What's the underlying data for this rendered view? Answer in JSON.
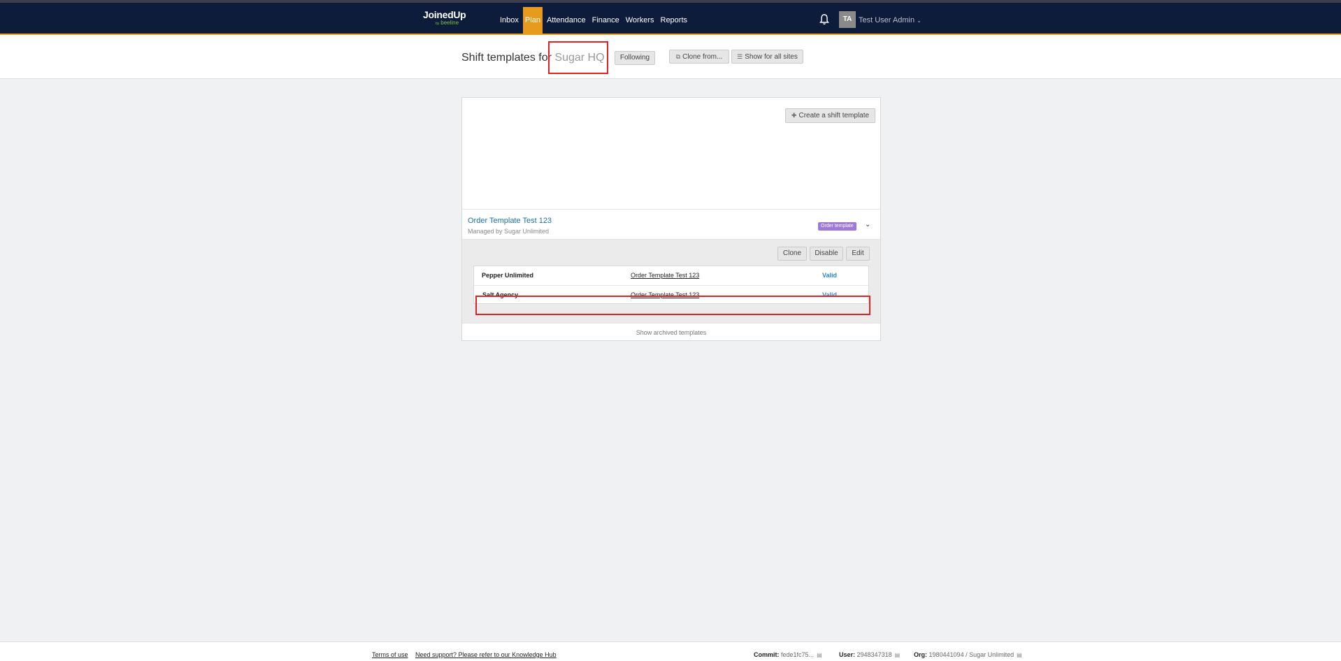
{
  "nav": {
    "logo_main": "JoinedUp",
    "logo_by": "by",
    "logo_sub": "beeline",
    "items": [
      {
        "label": "Inbox",
        "active": false
      },
      {
        "label": "Plan",
        "active": true
      },
      {
        "label": "Attendance",
        "active": false
      },
      {
        "label": "Finance",
        "active": false
      },
      {
        "label": "Workers",
        "active": false
      },
      {
        "label": "Reports",
        "active": false
      }
    ],
    "avatar_initials": "TA",
    "user_name": "Test User Admin",
    "accent": "#e69a1e",
    "bg": "#0e1c3b"
  },
  "header": {
    "title_prefix": "Shift templates for ",
    "site_name": "Sugar HQ",
    "following_label": "Following",
    "clone_label": "Clone from...",
    "show_all_label": "Show for all sites"
  },
  "card": {
    "create_label": "Create a shift template",
    "template": {
      "name": "Order Template Test 123",
      "managed_by": "Managed by Sugar Unlimited",
      "badge": "Order template",
      "badge_color": "#9e79d6"
    },
    "actions": {
      "clone": "Clone",
      "disable": "Disable",
      "edit": "Edit"
    },
    "rows": [
      {
        "agency": "Pepper Unlimited",
        "template": "Order Template Test 123",
        "status": "Valid"
      },
      {
        "agency": "Salt Agency",
        "template": "Order Template Test 123",
        "status": "Valid"
      }
    ],
    "show_archived": "Show archived templates"
  },
  "footer": {
    "terms": "Terms of use",
    "support": "Need support? Please refer to our Knowledge Hub",
    "commit_label": "Commit:",
    "commit_value": "fede1fc75...",
    "user_label": "User:",
    "user_value": "2948347318",
    "org_label": "Org:",
    "org_value": "1980441094 / Sugar Unlimited"
  }
}
